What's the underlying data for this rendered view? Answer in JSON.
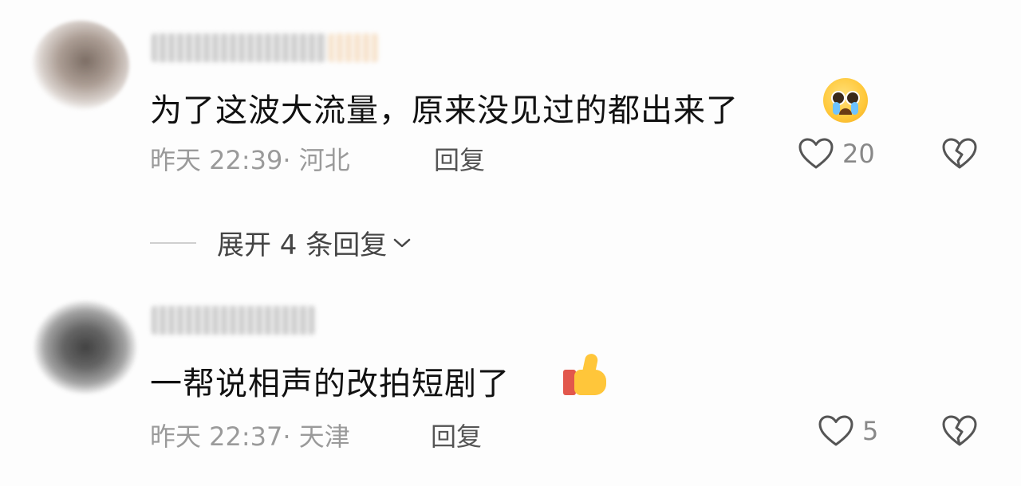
{
  "comments": [
    {
      "text": "为了这波大流量，原来没见过的都出来了",
      "emoji": "loudly-crying-face-emoji",
      "timestamp": "昨天 22:39",
      "separator": "·",
      "location": "河北",
      "reply_label": "回复",
      "like_count": "20",
      "liked": false
    },
    {
      "text": "一帮说相声的改拍短剧了",
      "emoji": "thumbs-up-emoji",
      "timestamp": "昨天 22:37",
      "separator": "·",
      "location": "天津",
      "reply_label": "回复",
      "like_count": "5",
      "liked": false
    }
  ],
  "expand_replies": {
    "label": "展开 4 条回复"
  },
  "icons": {
    "like": "heart-outline-icon",
    "dislike": "broken-heart-icon",
    "expand": "chevron-down-icon"
  },
  "colors": {
    "text_primary": "#111111",
    "text_secondary": "#9a9a9a",
    "icon_stroke": "#555555"
  }
}
